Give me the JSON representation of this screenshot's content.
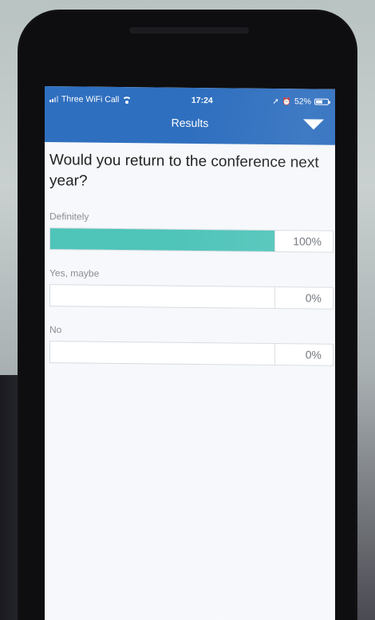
{
  "status_bar": {
    "carrier": "Three WiFi Call",
    "time": "17:24",
    "battery": "52%"
  },
  "nav": {
    "title": "Results",
    "menu_icon": "triangle-down-icon"
  },
  "poll": {
    "question": "Would you return to the conference next year?",
    "options": [
      {
        "label": "Definitely",
        "percent_text": "100%",
        "percent": 100
      },
      {
        "label": "Yes, maybe",
        "percent_text": "0%",
        "percent": 0
      },
      {
        "label": "No",
        "percent_text": "0%",
        "percent": 0
      }
    ]
  },
  "colors": {
    "navbar": "#2f6fbf",
    "bar_fill": "#4fc4b9"
  }
}
